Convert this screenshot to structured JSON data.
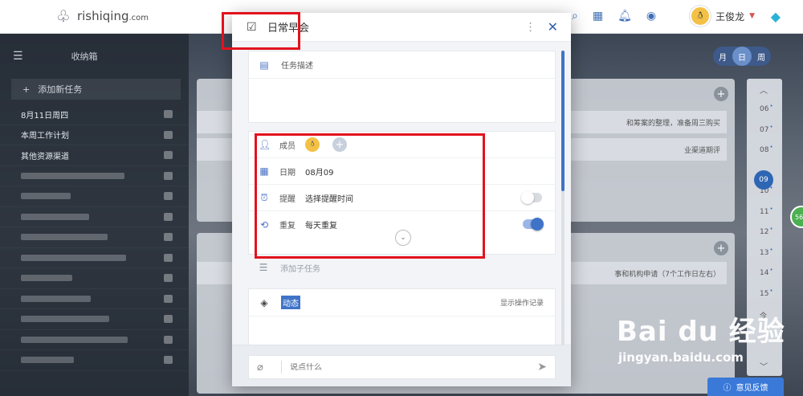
{
  "site": {
    "logo_text": "rishiqing",
    "logo_suffix": ".com",
    "user_name": "王俊龙"
  },
  "sidebar": {
    "header": "收纳箱",
    "add_task": "添加新任务",
    "items": [
      {
        "label": "8月11日周四"
      },
      {
        "label": "本周工作计划"
      },
      {
        "label": "其他资源渠道"
      },
      {
        "label": ""
      },
      {
        "label": ""
      },
      {
        "label": ""
      },
      {
        "label": ""
      },
      {
        "label": ""
      },
      {
        "label": ""
      },
      {
        "label": ""
      },
      {
        "label": ""
      },
      {
        "label": ""
      },
      {
        "label": ""
      }
    ]
  },
  "view_switch": {
    "month": "月",
    "day": "日",
    "week": "周"
  },
  "background_cards": {
    "card1_line1": "和筹案的整理，准备周三购买",
    "card1_line2": "业渠道期评",
    "card2_line1": "事和机构申请（7个工作日左右）"
  },
  "timeline": {
    "hours": [
      "06",
      "07",
      "08",
      "09",
      "10",
      "11",
      "12",
      "13",
      "14",
      "15",
      "今"
    ],
    "current": "09"
  },
  "green_badge": "56",
  "feedback": "意见反馈",
  "modal": {
    "title": "日常早会",
    "description_label": "任务描述",
    "member_label": "成员",
    "date_label": "日期",
    "date_value": "08月09",
    "reminder_label": "提醒",
    "reminder_value": "选择提醒时间",
    "reminder_on": false,
    "repeat_label": "重复",
    "repeat_value": "每天重复",
    "repeat_on": true,
    "subtask_placeholder": "添加子任务",
    "activity_label": "动态",
    "history_link": "显示操作记录",
    "comment_placeholder": "说点什么"
  },
  "watermark": {
    "main": "Bai du 经验",
    "sub": "jingyan.baidu.com"
  },
  "colors": {
    "accent": "#3f73c8",
    "annotation": "#e3121e",
    "feedback": "#3a79d8"
  },
  "icons": {
    "logo": "balloon-icon",
    "search": "search-icon",
    "apps": "grid-icon",
    "bell": "bell-icon",
    "profile": "user-circle-icon",
    "gem": "diamond-icon"
  }
}
